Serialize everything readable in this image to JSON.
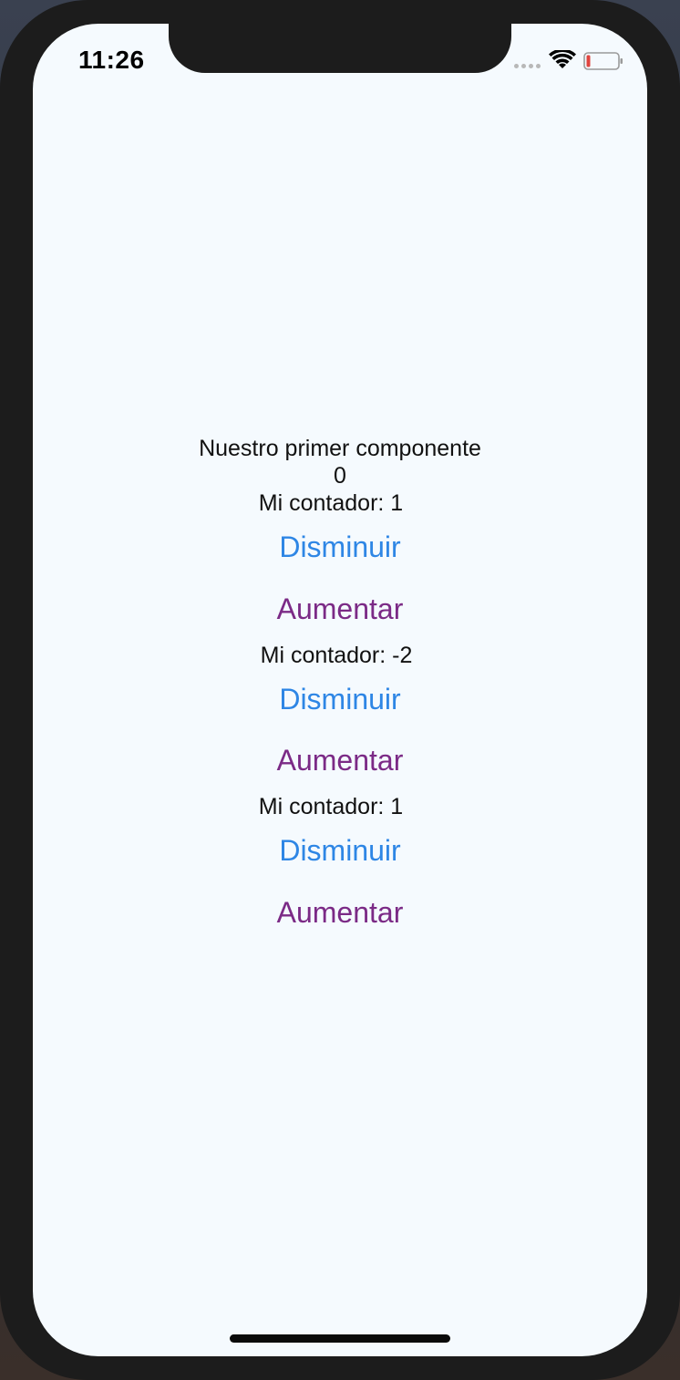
{
  "status_bar": {
    "time": "11:26",
    "icons": [
      "cellular-signal-icon",
      "wifi-icon",
      "battery-low-icon"
    ],
    "battery_color": "#e0443e"
  },
  "app": {
    "title": "Nuestro primer componente",
    "value": "0",
    "counters": [
      {
        "label": "Mi contador: 1",
        "decrease_label": "Disminuir",
        "increase_label": "Aumentar"
      },
      {
        "label": "Mi contador: -2",
        "decrease_label": "Disminuir",
        "increase_label": "Aumentar"
      },
      {
        "label": "Mi contador: 1",
        "decrease_label": "Disminuir",
        "increase_label": "Aumentar"
      }
    ]
  },
  "colors": {
    "background": "#f5fafe",
    "decrease_button": "#2e86e5",
    "increase_button": "#7b2a86",
    "text": "#111111"
  }
}
